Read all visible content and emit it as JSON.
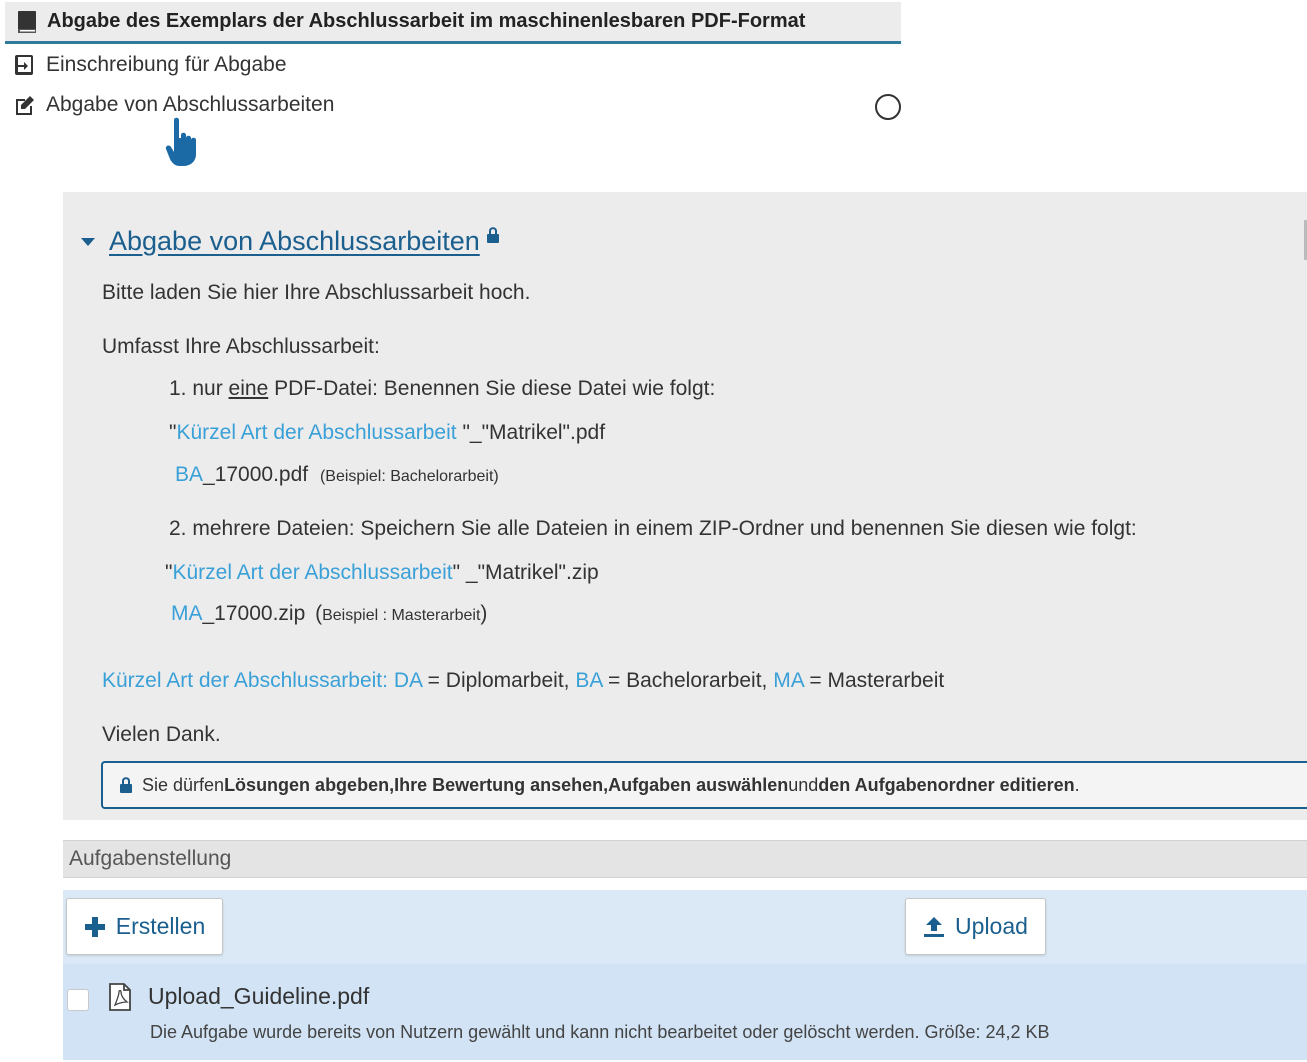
{
  "header": {
    "title": "Abgabe des Exemplars der Abschlussarbeit im maschinenlesbaren PDF-Format"
  },
  "nav": {
    "item1": "Einschreibung für Abgabe",
    "item2": "Abgabe von Abschlussarbeiten"
  },
  "panel": {
    "title": "Abgabe von Abschlussarbeiten",
    "intro": "Bitte laden Sie hier Ihre Abschlussarbeit hoch.",
    "question": "Umfasst Ihre Abschlussarbeit:",
    "item1_prefix": "1. nur ",
    "item1_emph": "eine",
    "item1_suffix": " PDF-Datei: Benennen Sie diese Datei wie folgt:",
    "item1_q1": "\"",
    "item1_link": "Kürzel Art der Abschlussarbeit ",
    "item1_rest": "\"_\"Matrikel\".pdf",
    "ex1_code": "BA",
    "ex1_rest": "_17000.pdf",
    "ex1_note": "(Beispiel: Bachelorarbeit)",
    "item2": "2. mehrere Dateien: Speichern Sie alle Dateien in einem ZIP-Ordner und benennen Sie diesen wie folgt:",
    "item2_q1": "\"",
    "item2_link": "Kürzel Art der Abschlussarbeit",
    "item2_rest": "\" _\"Matrikel\".zip",
    "ex2_code": "MA",
    "ex2_rest": "_17000.zip",
    "ex2_note_open": "(",
    "ex2_note": "Beispiel : Masterarbeit",
    "ex2_note_close": ")",
    "legend_label": "Kürzel Art der Abschlussarbeit",
    "legend_colon": ":",
    "legend_da": "DA",
    "legend_da_text": " = Diplomarbeit, ",
    "legend_ba": "BA",
    "legend_ba_text": " = Bachelorarbeit, ",
    "legend_ma": "MA",
    "legend_ma_text": " = Masterarbeit",
    "thanks": "Vielen Dank.",
    "notice_prefix": "Sie dürfen ",
    "notice_b1": "Lösungen abgeben",
    "notice_sep1": ", ",
    "notice_b2": "Ihre Bewertung ansehen",
    "notice_sep2": ", ",
    "notice_b3": "Aufgaben auswählen",
    "notice_and": " und ",
    "notice_b4": "den Aufgabenordner editieren",
    "notice_end": "."
  },
  "section": {
    "title": "Aufgabenstellung"
  },
  "toolbar": {
    "create_label": "Erstellen",
    "upload_label": "Upload"
  },
  "file": {
    "name": "Upload_Guideline.pdf",
    "description": "Die Aufgabe wurde bereits von Nutzern gewählt und kann nicht bearbeitet oder gelöscht werden. Größe: 24,2 KB"
  },
  "colors": {
    "accent": "#1b5f8f",
    "link_light": "#3aa0d8",
    "panel_bg": "#ececec",
    "row_bg": "#d1e3f4",
    "header_underline": "#2e7b9a"
  },
  "icons": {
    "header": "book-icon",
    "nav1": "sign-in-icon",
    "nav2": "edit-icon",
    "status": "circle-outline-icon",
    "cursor": "hand-pointer-icon",
    "lock": "lock-icon",
    "create": "plus-icon",
    "upload": "upload-icon",
    "file": "pdf-file-icon"
  }
}
